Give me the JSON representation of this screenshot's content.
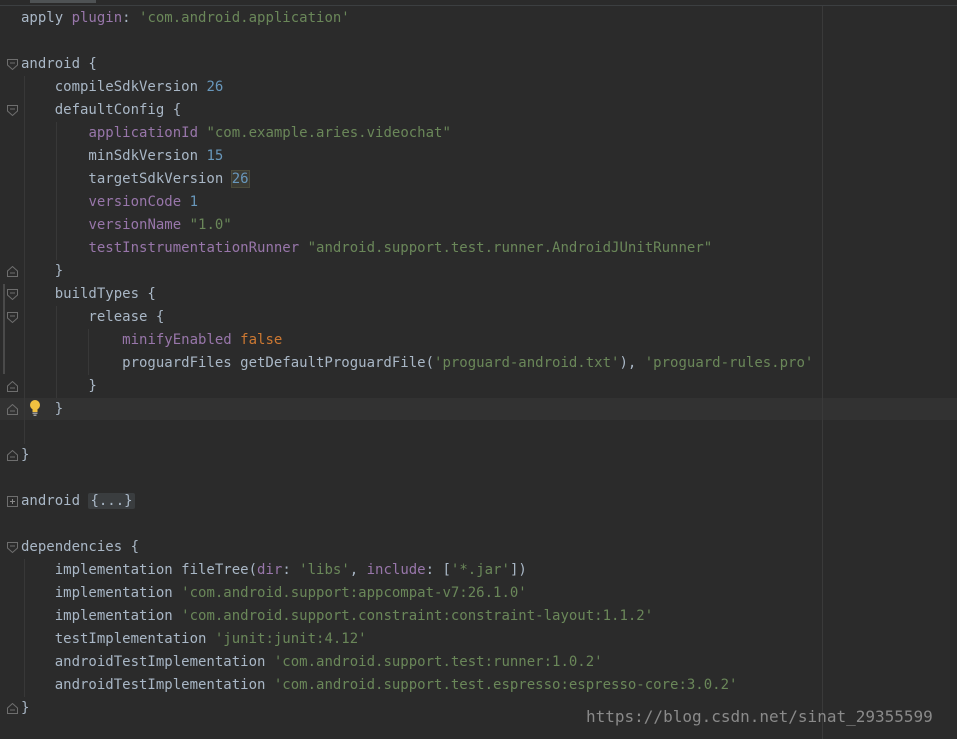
{
  "editor": {
    "language": "groovy",
    "lines": [
      {
        "n": 1,
        "parts": [
          [
            "apply ",
            "id"
          ],
          [
            "plugin",
            "named"
          ],
          [
            ": ",
            "id"
          ],
          [
            "'com.android.application'",
            "str"
          ]
        ]
      },
      {
        "n": 2,
        "parts": []
      },
      {
        "n": 3,
        "parts": [
          [
            "android {",
            "id"
          ]
        ]
      },
      {
        "n": 4,
        "parts": [
          [
            "    compileSdkVersion ",
            "id"
          ],
          [
            "26",
            "num"
          ]
        ]
      },
      {
        "n": 5,
        "parts": [
          [
            "    defaultConfig {",
            "id"
          ]
        ]
      },
      {
        "n": 6,
        "parts": [
          [
            "        ",
            "id"
          ],
          [
            "applicationId",
            "prop"
          ],
          [
            " ",
            "id"
          ],
          [
            "\"com.example.aries.videochat\"",
            "str"
          ]
        ]
      },
      {
        "n": 7,
        "parts": [
          [
            "        minSdkVersion ",
            "id"
          ],
          [
            "15",
            "num"
          ]
        ]
      },
      {
        "n": 8,
        "parts": [
          [
            "        targetSdkVersion ",
            "id"
          ],
          [
            "26",
            "hl-num"
          ]
        ]
      },
      {
        "n": 9,
        "parts": [
          [
            "        ",
            "id"
          ],
          [
            "versionCode",
            "prop"
          ],
          [
            " ",
            "id"
          ],
          [
            "1",
            "num"
          ]
        ]
      },
      {
        "n": 10,
        "parts": [
          [
            "        ",
            "id"
          ],
          [
            "versionName",
            "prop"
          ],
          [
            " ",
            "id"
          ],
          [
            "\"1.0\"",
            "str"
          ]
        ]
      },
      {
        "n": 11,
        "parts": [
          [
            "        ",
            "id"
          ],
          [
            "testInstrumentationRunner",
            "prop"
          ],
          [
            " ",
            "id"
          ],
          [
            "\"android.support.test.runner.AndroidJUnitRunner\"",
            "str"
          ]
        ]
      },
      {
        "n": 12,
        "parts": [
          [
            "    }",
            "id"
          ]
        ]
      },
      {
        "n": 13,
        "parts": [
          [
            "    buildTypes {",
            "id"
          ]
        ]
      },
      {
        "n": 14,
        "parts": [
          [
            "        release {",
            "id"
          ]
        ]
      },
      {
        "n": 15,
        "parts": [
          [
            "            ",
            "id"
          ],
          [
            "minifyEnabled",
            "prop"
          ],
          [
            " ",
            "id"
          ],
          [
            "false",
            "kw"
          ]
        ]
      },
      {
        "n": 16,
        "parts": [
          [
            "            proguardFiles getDefaultProguardFile(",
            "id"
          ],
          [
            "'proguard-android.txt'",
            "str"
          ],
          [
            "), ",
            "id"
          ],
          [
            "'proguard-rules.pro'",
            "str"
          ]
        ]
      },
      {
        "n": 17,
        "parts": [
          [
            "        }",
            "id"
          ]
        ]
      },
      {
        "n": 18,
        "parts": [
          [
            "    }",
            "id"
          ]
        ]
      },
      {
        "n": 19,
        "parts": []
      },
      {
        "n": 20,
        "parts": [
          [
            "}",
            "id"
          ]
        ]
      },
      {
        "n": 21,
        "parts": []
      },
      {
        "n": 22,
        "parts": [
          [
            "android ",
            "id"
          ],
          [
            "{...}",
            "folded"
          ]
        ]
      },
      {
        "n": 23,
        "parts": []
      },
      {
        "n": 24,
        "parts": [
          [
            "dependencies {",
            "id"
          ]
        ]
      },
      {
        "n": 25,
        "parts": [
          [
            "    implementation fileTree(",
            "id"
          ],
          [
            "dir",
            "named"
          ],
          [
            ": ",
            "id"
          ],
          [
            "'libs'",
            "str"
          ],
          [
            ", ",
            "id"
          ],
          [
            "include",
            "named"
          ],
          [
            ": [",
            "id"
          ],
          [
            "'*.jar'",
            "str"
          ],
          [
            "])",
            "id"
          ]
        ]
      },
      {
        "n": 26,
        "parts": [
          [
            "    implementation ",
            "id"
          ],
          [
            "'com.android.support:appcompat-v7:26.1.0'",
            "str"
          ]
        ]
      },
      {
        "n": 27,
        "parts": [
          [
            "    implementation ",
            "id"
          ],
          [
            "'com.android.support.constraint:constraint-layout:1.1.2'",
            "str"
          ]
        ]
      },
      {
        "n": 28,
        "parts": [
          [
            "    testImplementation ",
            "id"
          ],
          [
            "'junit:junit:4.12'",
            "str"
          ]
        ]
      },
      {
        "n": 29,
        "parts": [
          [
            "    androidTestImplementation ",
            "id"
          ],
          [
            "'com.android.support.test:runner:1.0.2'",
            "str"
          ]
        ]
      },
      {
        "n": 30,
        "parts": [
          [
            "    androidTestImplementation ",
            "id"
          ],
          [
            "'com.android.support.test.espresso:espresso-core:3.0.2'",
            "str"
          ]
        ]
      },
      {
        "n": 31,
        "parts": [
          [
            "}",
            "id"
          ]
        ]
      }
    ],
    "folds": [
      {
        "line": 3,
        "kind": "open"
      },
      {
        "line": 5,
        "kind": "open"
      },
      {
        "line": 12,
        "kind": "close"
      },
      {
        "line": 13,
        "kind": "open"
      },
      {
        "line": 14,
        "kind": "open"
      },
      {
        "line": 17,
        "kind": "close"
      },
      {
        "line": 18,
        "kind": "close"
      },
      {
        "line": 20,
        "kind": "close"
      },
      {
        "line": 22,
        "kind": "collapsed"
      },
      {
        "line": 24,
        "kind": "open"
      },
      {
        "line": 31,
        "kind": "close"
      }
    ],
    "caret_line": 18,
    "intention_icon": "lightbulb-icon"
  },
  "colors": {
    "background": "#2b2b2b",
    "text": "#a9b7c6",
    "keyword": "#cc7832",
    "string": "#6a8759",
    "number": "#6897bb",
    "property": "#9876aa",
    "caret_row": "#323232"
  },
  "watermark": "https://blog.csdn.net/sinat_29355599"
}
